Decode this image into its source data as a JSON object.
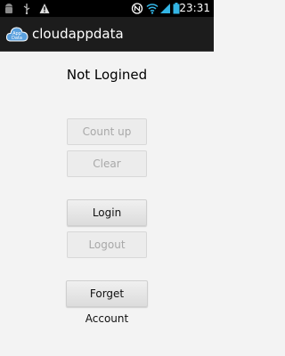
{
  "status_bar": {
    "time": "23:31",
    "icons": [
      "android-icon",
      "usb-icon",
      "warning-icon",
      "nfc-icon",
      "wifi-icon",
      "signal-icon",
      "battery-icon"
    ]
  },
  "action_bar": {
    "title": "cloudappdata",
    "icon_text_top": "App",
    "icon_text_bottom": "Data"
  },
  "main": {
    "status_text": "Not Logined",
    "buttons": {
      "count_up": "Count up",
      "clear": "Clear",
      "login": "Login",
      "logout": "Logout",
      "forget_account": "Forget Account"
    }
  },
  "colors": {
    "statusbar_bg": "#000000",
    "actionbar_bg": "#1c1c1c",
    "content_bg": "#f3f3f3",
    "cloud_icon": "#5aa0de"
  }
}
